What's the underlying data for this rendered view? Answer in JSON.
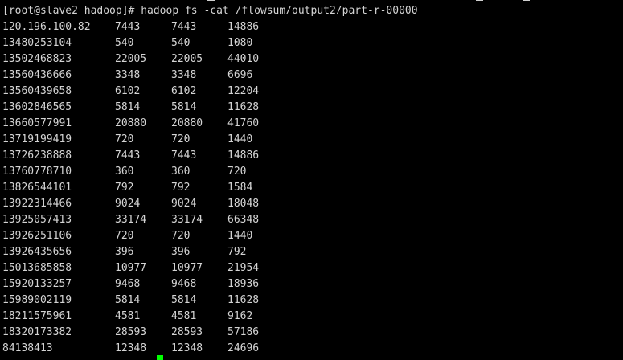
{
  "terminal": {
    "prompt": "[root@slave2 hadoop]# ",
    "command": "hadoop fs -cat /flowsum/output2/part-r-00000",
    "colors": {
      "background": "#000000",
      "text": "#d4d4d4",
      "cursor": "#00ff00"
    },
    "rows": [
      [
        "120.196.100.82",
        "7443",
        "7443",
        "14886"
      ],
      [
        "13480253104",
        "540",
        "540",
        "1080"
      ],
      [
        "13502468823",
        "22005",
        "22005",
        "44010"
      ],
      [
        "13560436666",
        "3348",
        "3348",
        "6696"
      ],
      [
        "13560439658",
        "6102",
        "6102",
        "12204"
      ],
      [
        "13602846565",
        "5814",
        "5814",
        "11628"
      ],
      [
        "13660577991",
        "20880",
        "20880",
        "41760"
      ],
      [
        "13719199419",
        "720",
        "720",
        "1440"
      ],
      [
        "13726238888",
        "7443",
        "7443",
        "14886"
      ],
      [
        "13760778710",
        "360",
        "360",
        "720"
      ],
      [
        "13826544101",
        "792",
        "792",
        "1584"
      ],
      [
        "13922314466",
        "9024",
        "9024",
        "18048"
      ],
      [
        "13925057413",
        "33174",
        "33174",
        "66348"
      ],
      [
        "13926251106",
        "720",
        "720",
        "1440"
      ],
      [
        "13926435656",
        "396",
        "396",
        "792"
      ],
      [
        "15013685858",
        "10977",
        "10977",
        "21954"
      ],
      [
        "15920133257",
        "9468",
        "9468",
        "18936"
      ],
      [
        "15989002119",
        "5814",
        "5814",
        "11628"
      ],
      [
        "18211575961",
        "4581",
        "4581",
        "9162"
      ],
      [
        "18320173382",
        "28593",
        "28593",
        "57186"
      ],
      [
        "84138413",
        "12348",
        "12348",
        "24696"
      ]
    ]
  }
}
